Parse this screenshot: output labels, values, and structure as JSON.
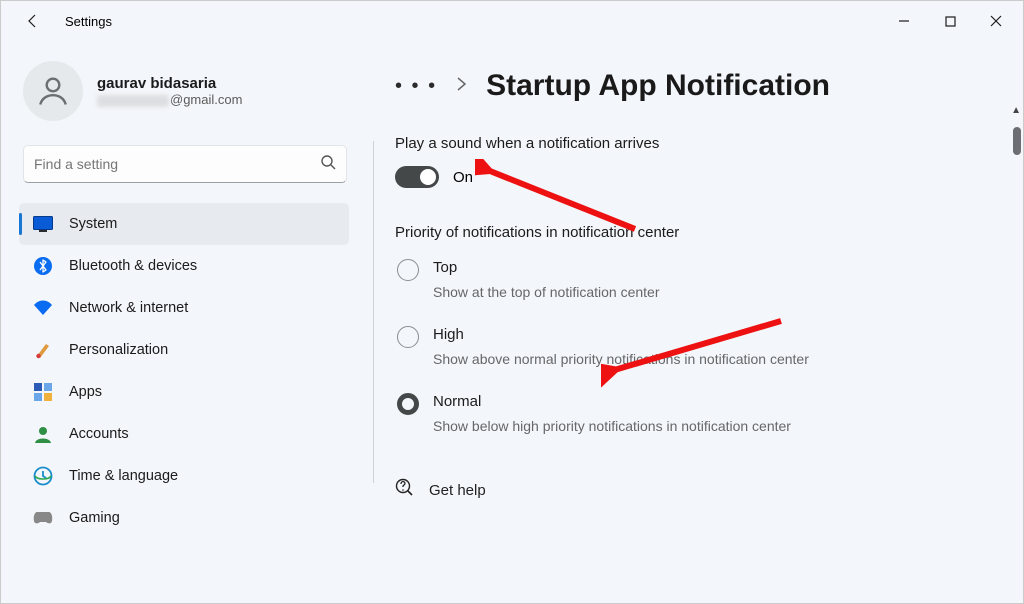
{
  "window": {
    "title": "Settings"
  },
  "profile": {
    "name": "gaurav bidasaria",
    "email_domain": "@gmail.com"
  },
  "search": {
    "placeholder": "Find a setting"
  },
  "sidebar": {
    "items": [
      {
        "label": "System",
        "icon": "system",
        "selected": true
      },
      {
        "label": "Bluetooth & devices",
        "icon": "bluetooth",
        "selected": false
      },
      {
        "label": "Network & internet",
        "icon": "wifi",
        "selected": false
      },
      {
        "label": "Personalization",
        "icon": "brush",
        "selected": false
      },
      {
        "label": "Apps",
        "icon": "apps",
        "selected": false
      },
      {
        "label": "Accounts",
        "icon": "account",
        "selected": false
      },
      {
        "label": "Time & language",
        "icon": "clock",
        "selected": false
      },
      {
        "label": "Gaming",
        "icon": "gaming",
        "selected": false
      }
    ]
  },
  "main": {
    "breadcrumb_title": "Startup App Notification",
    "sound_label": "Play a sound when a notification arrives",
    "sound_toggle_state": "On",
    "priority_header": "Priority of notifications in notification center",
    "priority_options": [
      {
        "title": "Top",
        "desc": "Show at the top of notification center",
        "selected": false
      },
      {
        "title": "High",
        "desc": "Show above normal priority notifications in notification center",
        "selected": false
      },
      {
        "title": "Normal",
        "desc": "Show below high priority notifications in notification center",
        "selected": true
      }
    ],
    "help_label": "Get help"
  }
}
